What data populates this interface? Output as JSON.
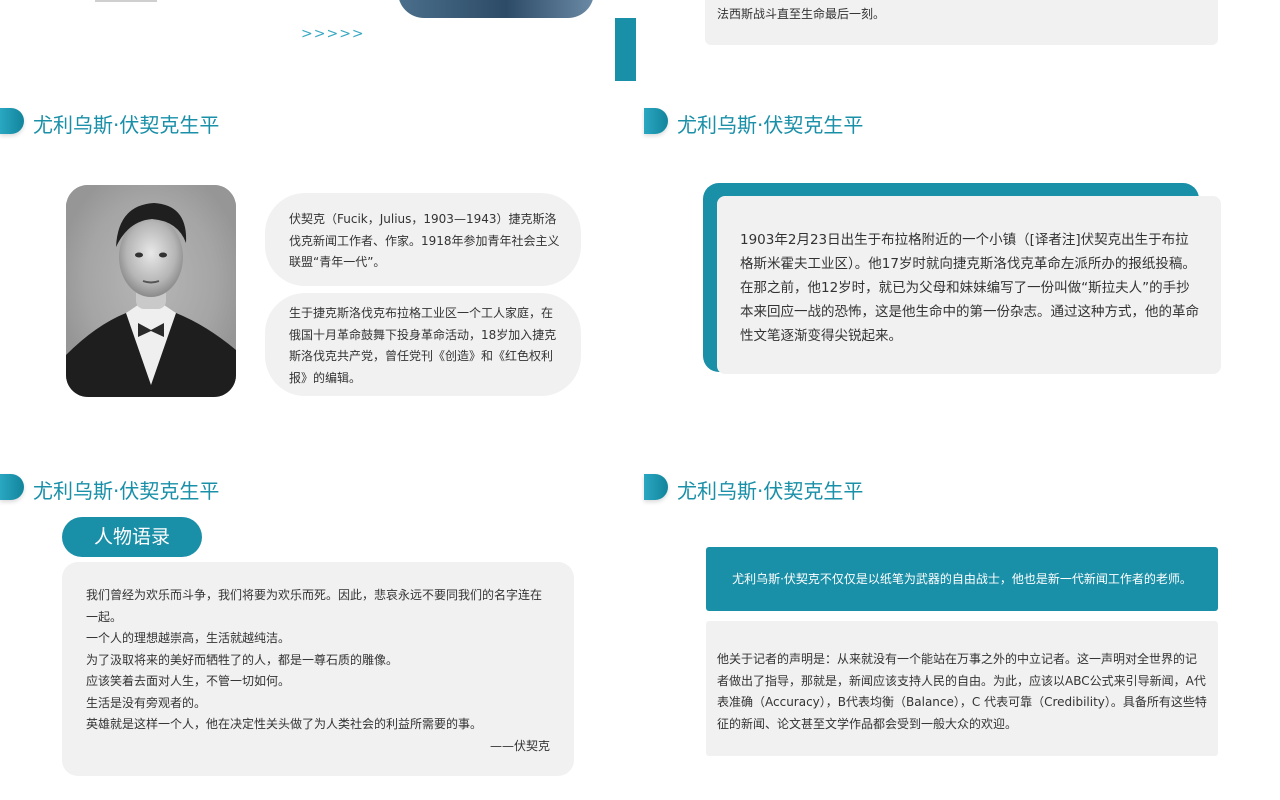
{
  "top_left": {
    "arrows": ">>>>>"
  },
  "top_right": {
    "card_tail_text": "法西斯战斗直至生命最后一刻。"
  },
  "slide_title": "尤利乌斯·伏契克生平",
  "slide_bio": {
    "pill1": "伏契克（Fucik，Julius，1903—1943）捷克斯洛伐克新闻工作者、作家。1918年参加青年社会主义联盟“青年一代”。",
    "pill2": "生于捷克斯洛伐克布拉格工业区一个工人家庭，在俄国十月革命鼓舞下投身革命活动，18岁加入捷克斯洛伐克共产党，曾任党刊《创造》和《红色权利报》的编辑。"
  },
  "slide_birth": {
    "text": "1903年2月23日出生于布拉格附近的一个小镇（[译者注]伏契克出生于布拉格斯米霍夫工业区）。他17岁时就向捷克斯洛伐克革命左派所办的报纸投稿。在那之前，他12岁时，就已为父母和妹妹编写了一份叫做“斯拉夫人”的手抄本来回应一战的恐怖，这是他生命中的第一份杂志。通过这种方式，他的革命性文笔逐渐变得尖锐起来。"
  },
  "slide_quotes": {
    "badge": "人物语录",
    "lines": [
      "我们曾经为欢乐而斗争，我们将要为欢乐而死。因此，悲哀永远不要同我们的名字连在一起。",
      "一个人的理想越崇高，生活就越纯洁。",
      "为了汲取将来的美好而牺牲了的人，都是一尊石质的雕像。",
      "应该笑着去面对人生，不管一切如何。",
      "生活是没有旁观者的。",
      "英雄就是这样一个人，他在决定性关头做了为人类社会的利益所需要的事。"
    ],
    "signature": "——伏契克"
  },
  "slide_journalist": {
    "banner": "尤利乌斯·伏契克不仅仅是以纸笔为武器的自由战士，他也是新一代新闻工作者的老师。",
    "text": "他关于记者的声明是：从来就没有一个能站在万事之外的中立记者。这一声明对全世界的记者做出了指导，那就是，新闻应该支持人民的自由。为此，应该以ABC公式来引导新闻，A代表准确（Accuracy），B代表均衡（Balance），C 代表可靠（Credibility）。具备所有这些特征的新闻、论文甚至文学作品都会受到一般大众的欢迎。"
  },
  "colors": {
    "accent": "#1a8fa8",
    "card_bg": "#f1f1f1"
  }
}
